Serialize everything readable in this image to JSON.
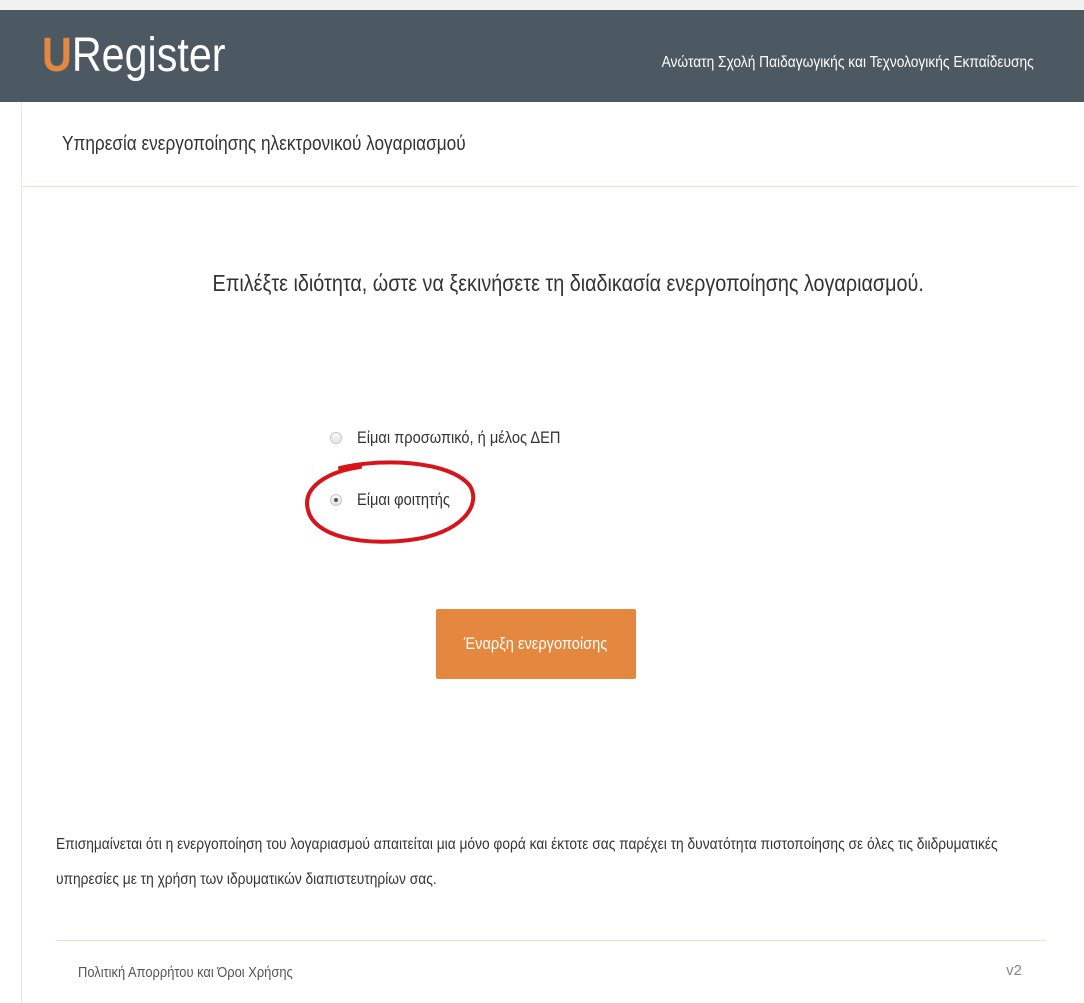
{
  "header": {
    "logo_first_letter": "U",
    "logo_rest": "Register",
    "institution": "Ανώτατη Σχολή Παιδαγωγικής και Τεχνολογικής Εκπαίδευσης"
  },
  "page": {
    "subtitle": "Υπηρεσία ενεργοποίησης ηλεκτρονικού λογαριασμού",
    "instruction": "Επιλέξτε ιδιότητα, ώστε να ξεκινήσετε τη διαδικασία ενεργοποίησης λογαριασμού."
  },
  "options": [
    {
      "label": "Είμαι προσωπικό, ή μέλος ΔΕΠ",
      "checked": false
    },
    {
      "label": "Είμαι φοιτητής",
      "checked": true
    }
  ],
  "start_button_label": "Έναρξη ενεργοποίσης",
  "notice": "Επισημαίνεται ότι η ενεργοποίηση του λογαριασμού απαιτείται μια μόνο φορά και έκτοτε σας παρέχει τη δυνατότητα πιστοποίησης σε όλες τις διιδρυματικές υπηρεσίες με τη χρήση των ιδρυματικών διαπιστευτηρίων σας.",
  "footer": {
    "privacy_link": "Πολιτική Απορρήτου και Όροι Χρήσης",
    "version": "v2"
  },
  "colors": {
    "header_bg": "#4c5862",
    "accent_orange": "#e3883e",
    "highlight_red": "#d8141b",
    "rule": "#f2dfc8"
  }
}
